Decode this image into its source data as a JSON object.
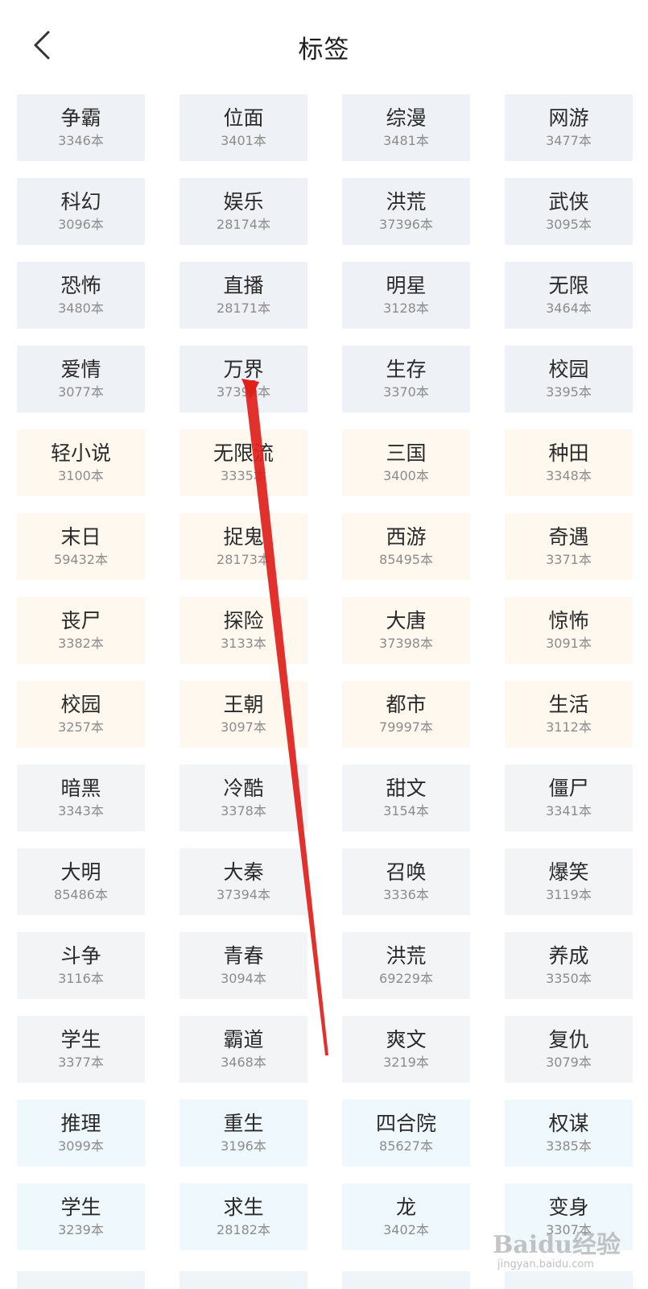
{
  "header": {
    "title": "标签",
    "back_icon": "chevron-left-icon"
  },
  "tags": [
    {
      "name": "争霸",
      "count": "3346本"
    },
    {
      "name": "位面",
      "count": "3401本"
    },
    {
      "name": "综漫",
      "count": "3481本"
    },
    {
      "name": "网游",
      "count": "3477本"
    },
    {
      "name": "科幻",
      "count": "3096本"
    },
    {
      "name": "娱乐",
      "count": "28174本"
    },
    {
      "name": "洪荒",
      "count": "37396本"
    },
    {
      "name": "武侠",
      "count": "3095本"
    },
    {
      "name": "恐怖",
      "count": "3480本"
    },
    {
      "name": "直播",
      "count": "28171本"
    },
    {
      "name": "明星",
      "count": "3128本"
    },
    {
      "name": "无限",
      "count": "3464本"
    },
    {
      "name": "爱情",
      "count": "3077本"
    },
    {
      "name": "万界",
      "count": "37399本"
    },
    {
      "name": "生存",
      "count": "3370本"
    },
    {
      "name": "校园",
      "count": "3395本"
    },
    {
      "name": "轻小说",
      "count": "3100本"
    },
    {
      "name": "无限流",
      "count": "3335本"
    },
    {
      "name": "三国",
      "count": "3400本"
    },
    {
      "name": "种田",
      "count": "3348本"
    },
    {
      "name": "末日",
      "count": "59432本"
    },
    {
      "name": "捉鬼",
      "count": "28173本"
    },
    {
      "name": "西游",
      "count": "85495本"
    },
    {
      "name": "奇遇",
      "count": "3371本"
    },
    {
      "name": "丧尸",
      "count": "3382本"
    },
    {
      "name": "探险",
      "count": "3133本"
    },
    {
      "name": "大唐",
      "count": "37398本"
    },
    {
      "name": "惊怖",
      "count": "3091本"
    },
    {
      "name": "校园",
      "count": "3257本"
    },
    {
      "name": "王朝",
      "count": "3097本"
    },
    {
      "name": "都市",
      "count": "79997本"
    },
    {
      "name": "生活",
      "count": "3112本"
    },
    {
      "name": "暗黑",
      "count": "3343本"
    },
    {
      "name": "冷酷",
      "count": "3378本"
    },
    {
      "name": "甜文",
      "count": "3154本"
    },
    {
      "name": "僵尸",
      "count": "3341本"
    },
    {
      "name": "大明",
      "count": "85486本"
    },
    {
      "name": "大秦",
      "count": "37394本"
    },
    {
      "name": "召唤",
      "count": "3336本"
    },
    {
      "name": "爆笑",
      "count": "3119本"
    },
    {
      "name": "斗争",
      "count": "3116本"
    },
    {
      "name": "青春",
      "count": "3094本"
    },
    {
      "name": "洪荒",
      "count": "69229本"
    },
    {
      "name": "养成",
      "count": "3350本"
    },
    {
      "name": "学生",
      "count": "3377本"
    },
    {
      "name": "霸道",
      "count": "3468本"
    },
    {
      "name": "爽文",
      "count": "3219本"
    },
    {
      "name": "复仇",
      "count": "3079本"
    },
    {
      "name": "推理",
      "count": "3099本"
    },
    {
      "name": "重生",
      "count": "3196本"
    },
    {
      "name": "四合院",
      "count": "85627本"
    },
    {
      "name": "权谋",
      "count": "3385本"
    },
    {
      "name": "学生",
      "count": "3239本"
    },
    {
      "name": "求生",
      "count": "28182本"
    },
    {
      "name": "龙",
      "count": "3402本"
    },
    {
      "name": "变身",
      "count": "3307本"
    }
  ],
  "colors": {
    "tag_bg_gray": "#eef1f5",
    "tag_bg_cream": "#fff8ee",
    "tag_bg_gray2": "#f3f4f6",
    "tag_bg_blue": "#eff8fc",
    "annotation_arrow": "#e0201b"
  },
  "watermark": {
    "brand": "Baidu经验",
    "url": "jingyan.baidu.com"
  }
}
